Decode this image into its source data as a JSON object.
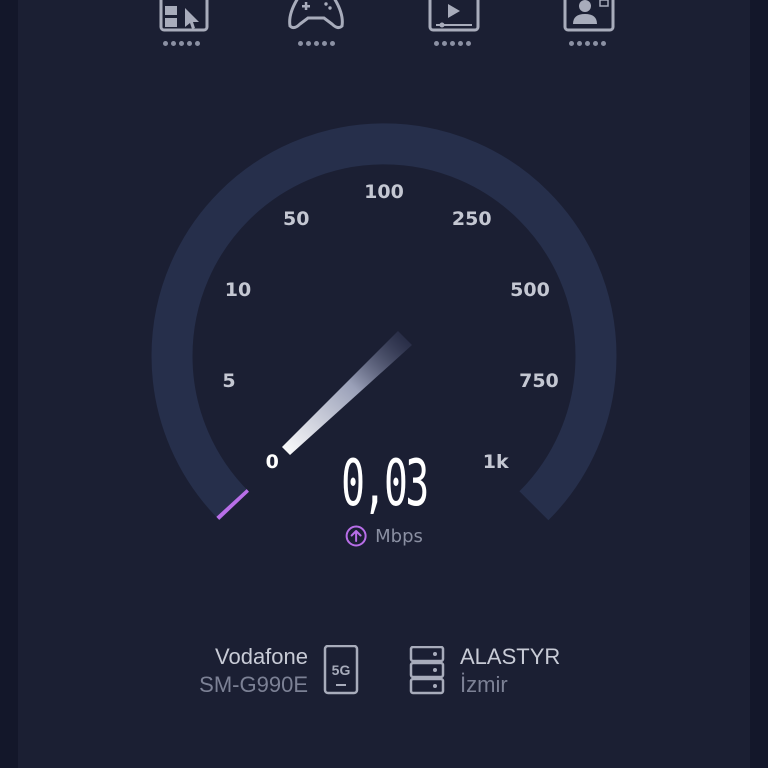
{
  "categories": [
    {
      "id": "browsing",
      "icon": "browser-cursor-icon"
    },
    {
      "id": "gaming",
      "icon": "gamepad-icon"
    },
    {
      "id": "video",
      "icon": "video-player-icon"
    },
    {
      "id": "video-call",
      "icon": "video-call-icon"
    }
  ],
  "gauge": {
    "ticks": [
      "0",
      "5",
      "10",
      "50",
      "100",
      "250",
      "500",
      "750",
      "1k"
    ],
    "speed": "0,03",
    "unit": "Mbps",
    "direction": "upload",
    "accent_color": "#b86ee8"
  },
  "provider": {
    "name": "Vodafone",
    "device": "SM-G990E",
    "network": "5G"
  },
  "server": {
    "name": "ALASTYR",
    "location": "İzmir"
  }
}
